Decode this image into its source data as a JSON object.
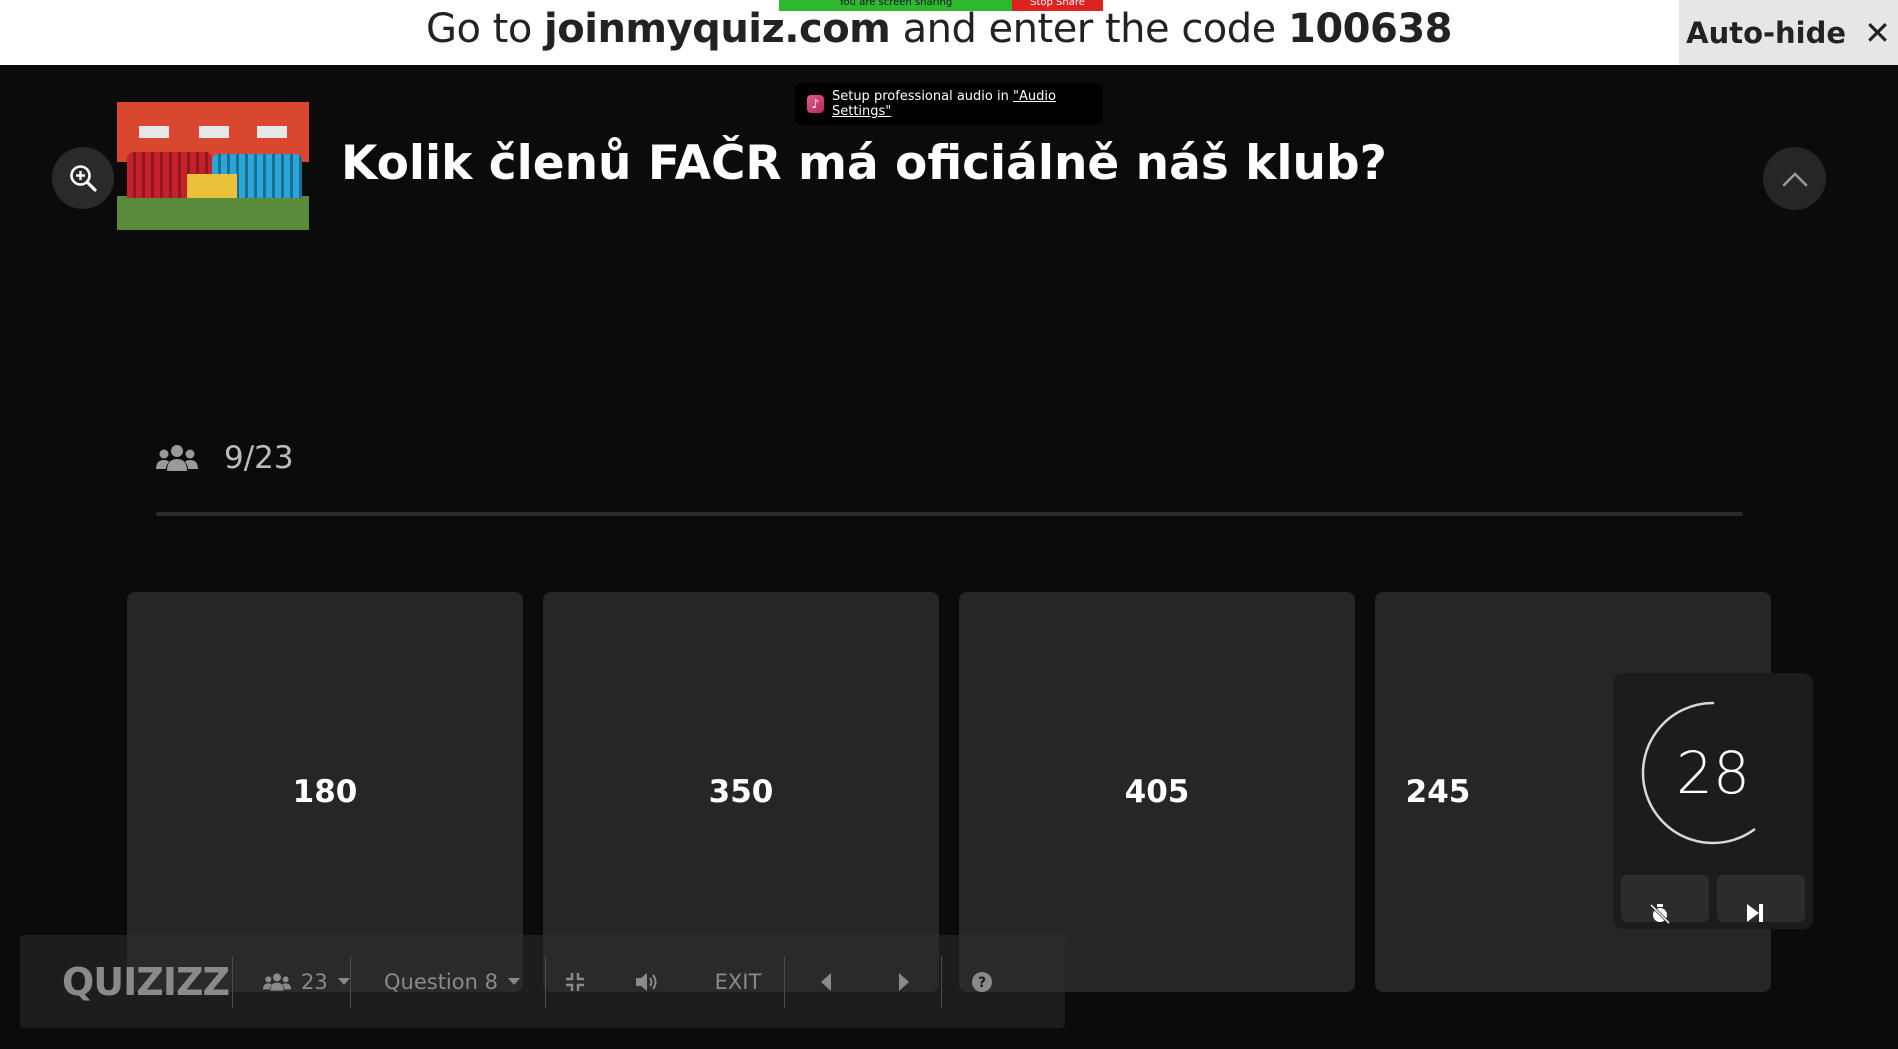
{
  "banner": {
    "prefix": "Go to ",
    "site": "joinmyquiz.com",
    "middle": " and enter the code ",
    "code": "100638",
    "autohide_label": "Auto-hide",
    "close_glyph": "✕"
  },
  "screen_share": {
    "status": "You are screen sharing",
    "stop_label": "Stop Share"
  },
  "audio_toast": {
    "text": "Setup professional audio in ",
    "link": "\"Audio Settings\""
  },
  "question": {
    "text": "Kolik členů FAČR má oficiálně náš klub?"
  },
  "responses": {
    "count": "9/23",
    "icon": "users-icon"
  },
  "answers": [
    {
      "label": "180"
    },
    {
      "label": "350"
    },
    {
      "label": "405"
    },
    {
      "label": "245"
    }
  ],
  "timer": {
    "seconds": "28",
    "remaining_fraction": 0.6
  },
  "toolbar": {
    "logo": "QUIZIZZ",
    "players": "23",
    "question": "Question 8",
    "exit": "EXIT"
  },
  "colors": {
    "background": "#0b0b0b",
    "card": "#262626",
    "banner": "#ffffff",
    "share_green": "#2db82d",
    "share_red": "#dd2222"
  }
}
